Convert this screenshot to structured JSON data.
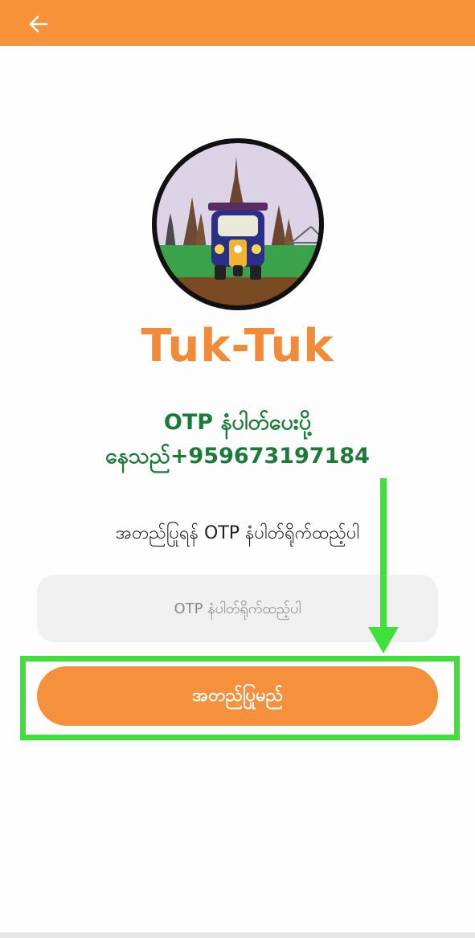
{
  "colors": {
    "accent": "#f7923a",
    "otp_text": "#1b7a37",
    "highlight": "#3fe03b"
  },
  "appbar": {
    "back_icon": "arrow-left-icon"
  },
  "brand": {
    "name": "Tuk-Tuk"
  },
  "otp_message": {
    "line1": "OTP နံပါတ်ပေးပို့",
    "line2": "နေသည်+959673197184"
  },
  "instruction": "အတည်ပြုရန် OTP နံပါတ်ရိုက်ထည့်ပါ",
  "otp_field": {
    "value": "",
    "placeholder": "OTP နံပါတ်ရိုက်ထည့်ပါ"
  },
  "confirm_button": {
    "label": "အတည်ပြုမည်"
  }
}
